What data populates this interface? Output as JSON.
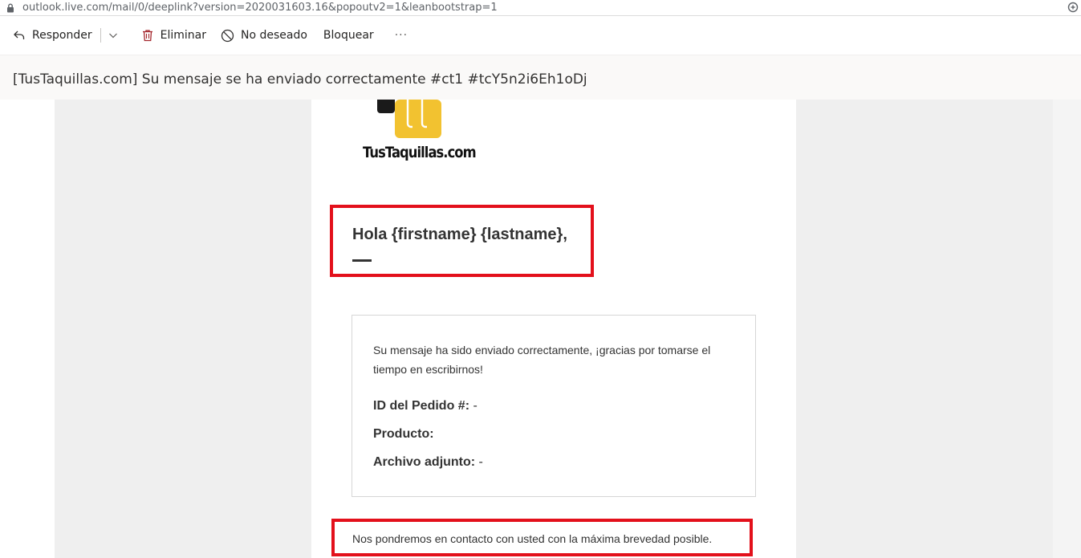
{
  "browser": {
    "url": "outlook.live.com/mail/0/deeplink?version=2020031603.16&popoutv2=1&leanbootstrap=1"
  },
  "toolbar": {
    "reply_label": "Responder",
    "delete_label": "Eliminar",
    "junk_label": "No deseado",
    "block_label": "Bloquear",
    "more_label": "···"
  },
  "message": {
    "subject": "[TusTaquillas.com] Su mensaje se ha enviado correctamente #ct1 #tcY5n2i6Eh1oDj"
  },
  "email": {
    "logo_text": "TusTaquillas.com",
    "greeting": "Hola {firstname} {lastname},",
    "body": "Su mensaje ha sido enviado correctamente, ¡gracias por tomarse el tiempo en escribirnos!",
    "fields": [
      {
        "label": "ID del Pedido #:",
        "value": " -"
      },
      {
        "label": "Producto:",
        "value": ""
      },
      {
        "label": "Archivo adjunto:",
        "value": " -"
      }
    ],
    "footer": "Nos pondremos en contacto con usted con la máxima brevedad posible."
  },
  "colors": {
    "highlight": "#e3101b",
    "logo_yellow": "#f2c230",
    "logo_black": "#1a1a1a"
  }
}
